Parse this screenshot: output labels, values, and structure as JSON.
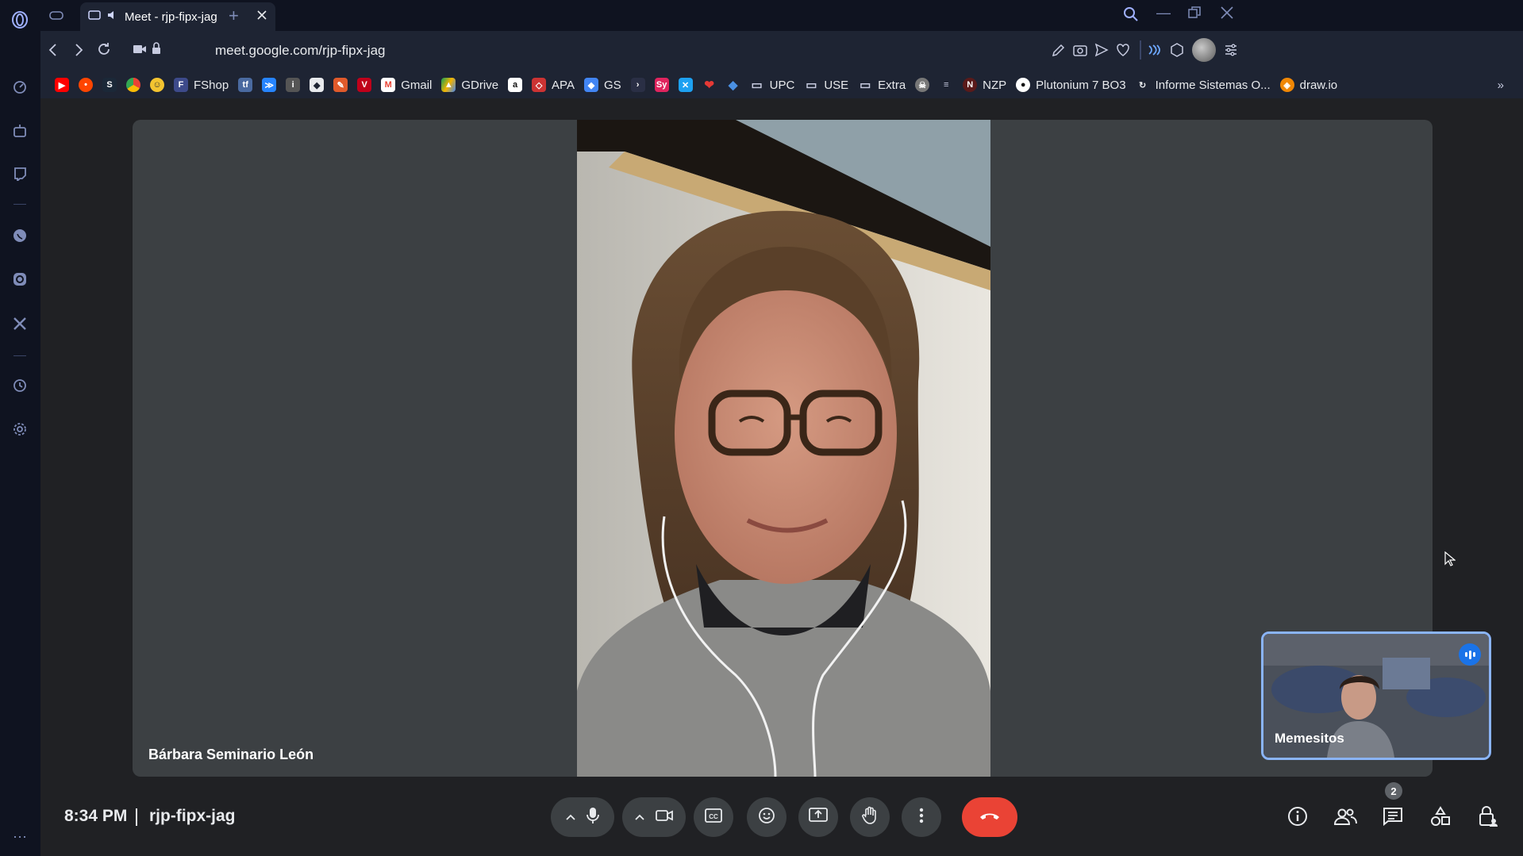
{
  "browser": {
    "tab": {
      "title": "Meet - rjp-fipx-jag"
    },
    "url": "meet.google.com/rjp-fipx-jag",
    "bookmarks": [
      "FShop",
      "Gmail",
      "GDrive",
      "APA",
      "GS",
      "UPC",
      "USE",
      "Extra",
      "NZP",
      "Plutonium 7 BO3",
      "Informe Sistemas O...",
      "draw.io"
    ]
  },
  "meet": {
    "participant_name": "Bárbara Seminario León",
    "self_name": "Memesitos",
    "time": "8:34 PM",
    "meeting_code": "rjp-fipx-jag",
    "people_count": "2"
  },
  "colors": {
    "accent": "#8ab4f8",
    "end_call": "#ea4335",
    "stage": "#3c4043",
    "meet_bg": "#202124"
  },
  "icons": [
    "opera-logo",
    "back",
    "forward",
    "reload",
    "camera",
    "lock",
    "search",
    "mic",
    "video",
    "captions",
    "emoji",
    "present",
    "raise-hand",
    "more",
    "end-call",
    "info",
    "people",
    "chat",
    "activities",
    "host-controls"
  ]
}
